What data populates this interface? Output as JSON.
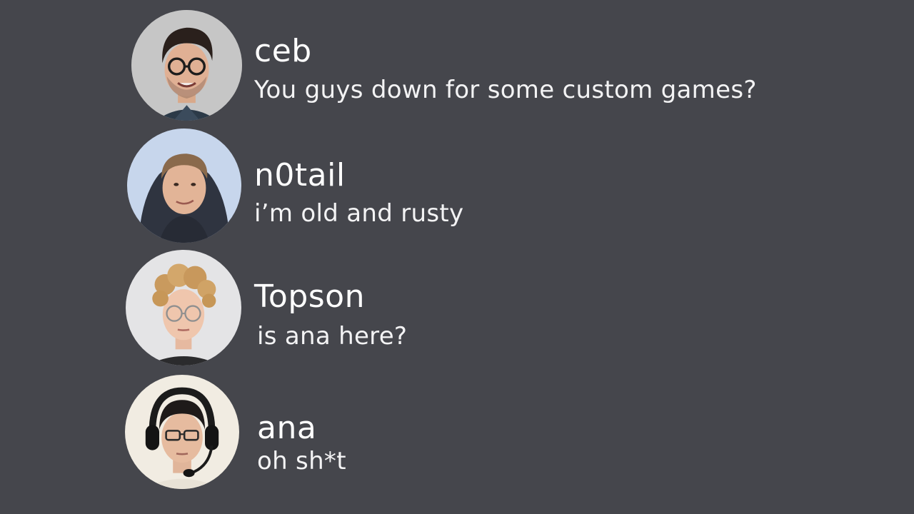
{
  "messages": [
    {
      "username": "ceb",
      "text": "You guys down for some custom games?",
      "avatar_icon": "ceb-avatar-photo"
    },
    {
      "username": "n0tail",
      "text": "i’m old and rusty",
      "avatar_icon": "n0tail-avatar-photo"
    },
    {
      "username": "Topson",
      "text": "is ana here?",
      "avatar_icon": "topson-avatar-photo"
    },
    {
      "username": "ana",
      "text": "oh sh*t",
      "avatar_icon": "ana-avatar-photo"
    }
  ],
  "colors": {
    "background": "#45464c",
    "text": "#ffffff"
  }
}
